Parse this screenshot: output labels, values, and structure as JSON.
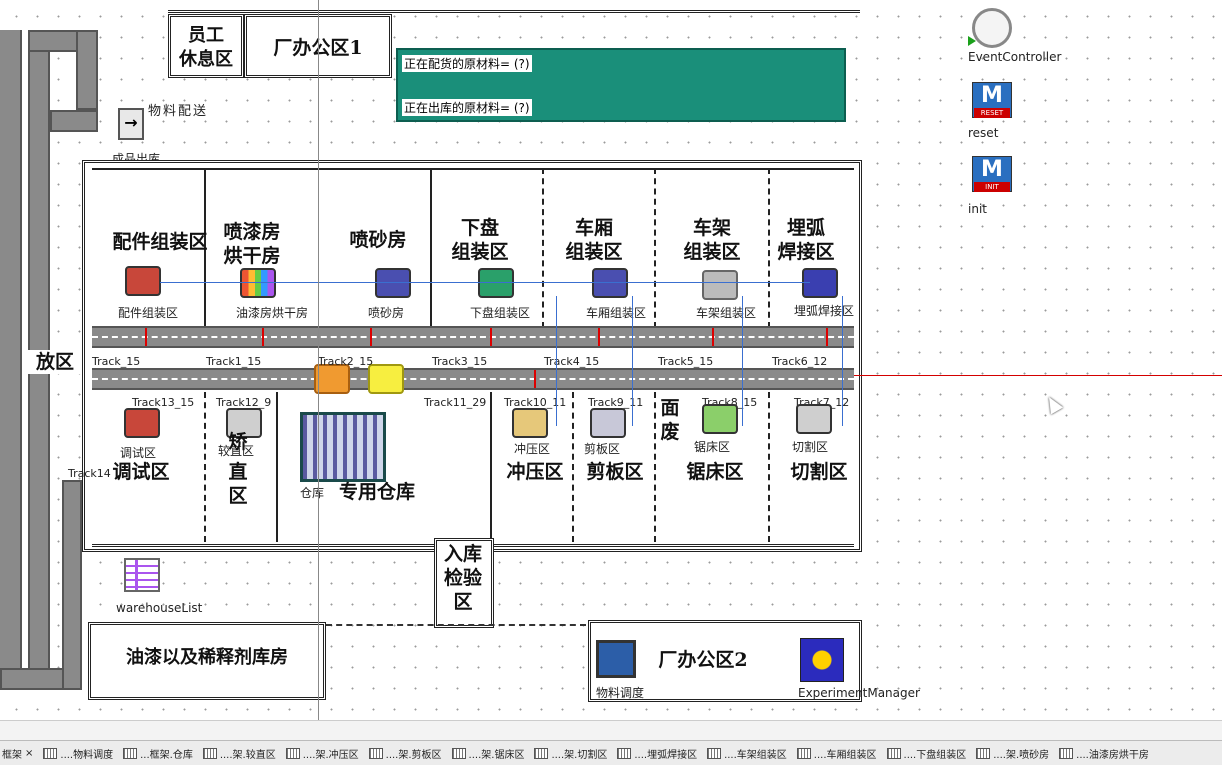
{
  "zones": {
    "staff_rest": "员工\n休息区",
    "office1": "厂办公区1",
    "office2": "厂办公区2",
    "parts_assembly": "配件组装区",
    "paint_dry": "喷漆房\n烘干房",
    "sandblast": "喷砂房",
    "chassis_assembly": "下盘\n组装区",
    "carriage_assembly": "车厢\n组装区",
    "frame_assembly": "车架\n组装区",
    "arc_weld": "埋弧\n焊接区",
    "storage_left": "放区",
    "debug": "调试区",
    "straighten": "直\n区",
    "straighten_top": "矫",
    "warehouse": "专用仓库",
    "stamping": "冲压区",
    "shearing": "剪板区",
    "sawing": "锯床区",
    "cutting": "切割区",
    "waste": "面\n废",
    "inbound_inspect": "入库\n检验\n区",
    "paint_storage": "油漆以及稀释剂库房"
  },
  "info_panel": {
    "line1": "正在配货的原材料= (?)",
    "line2": "正在出库的原材料= (?)",
    "color": "#1a8f7a"
  },
  "objects": {
    "material_delivery": "物料配送",
    "product_out": "成品出库",
    "parts_assembly": "配件组装区",
    "paint_dry": "油漆房烘干房",
    "sandblast": "喷砂房",
    "chassis": "下盘组装区",
    "carriage": "车厢组装区",
    "frame": "车架组装区",
    "arc_weld": "埋弧焊接区",
    "debug": "调试区",
    "straighten": "较直区",
    "warehouse": "仓库",
    "stamping": "冲压区",
    "shearing": "剪板区",
    "sawing": "锯床区",
    "cutting": "切割区",
    "warehouse_list": "warehouseList",
    "material_dispatch": "物料调度",
    "experiment_manager": "ExperimentManager",
    "event_controller": "EventController",
    "reset": "reset",
    "init": "init",
    "reset_badge": "RESET",
    "init_badge": "INIT"
  },
  "tracks": {
    "t15": "Track_15",
    "t1": "Track1_15",
    "t2": "Track2_15",
    "t3": "Track3_15",
    "t4": "Track4_15",
    "t5": "Track5_15",
    "t6": "Track6_12",
    "t13": "Track13_15",
    "t12": "Track12_9",
    "t11": "Track11_29",
    "t10": "Track10_11",
    "t9": "Track9_11",
    "t8": "Track8_15",
    "t7": "Track7_12",
    "t14": "Track14"
  },
  "tabs": [
    "框架",
    "....物料调度",
    "...框架.仓库",
    "....架.较直区",
    "....架.冲压区",
    "....架.剪板区",
    "....架.锯床区",
    "....架.切割区",
    "....埋弧焊接区",
    "....车架组装区",
    "....车厢组装区",
    "....下盘组装区",
    "....架.喷砂房",
    "....油漆房烘干房"
  ],
  "colors": {
    "track": "#8a8a8a",
    "panel": "#1a8f7a",
    "cursor_line": "#d40000"
  }
}
